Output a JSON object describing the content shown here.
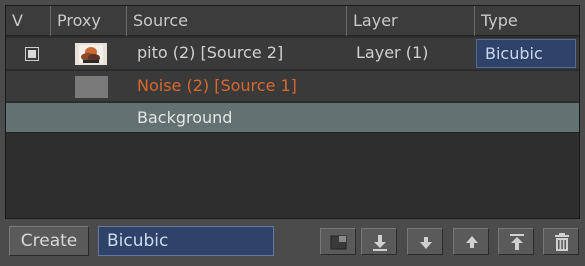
{
  "header": {
    "col_v": "V",
    "col_proxy": "Proxy",
    "col_source": "Source",
    "col_layer": "Layer",
    "col_type": "Type"
  },
  "rows": [
    {
      "source": "pito (2) [Source 2]",
      "layer": "Layer (1)",
      "type": "Bicubic",
      "checked": true
    },
    {
      "source": "Noise (2) [Source 1]",
      "layer": "",
      "type": ""
    },
    {
      "source": "Background",
      "layer": "",
      "type": ""
    }
  ],
  "bottom": {
    "create_label": "Create",
    "filter_value": "Bicubic",
    "icons": [
      "new-layer-icon",
      "move-to-bottom-icon",
      "move-down-icon",
      "move-up-icon",
      "move-to-top-icon",
      "trash-icon"
    ]
  },
  "colors": {
    "selected_blue": "#2f4268",
    "highlight_row": "#637170",
    "orange_text": "#d9682c"
  }
}
